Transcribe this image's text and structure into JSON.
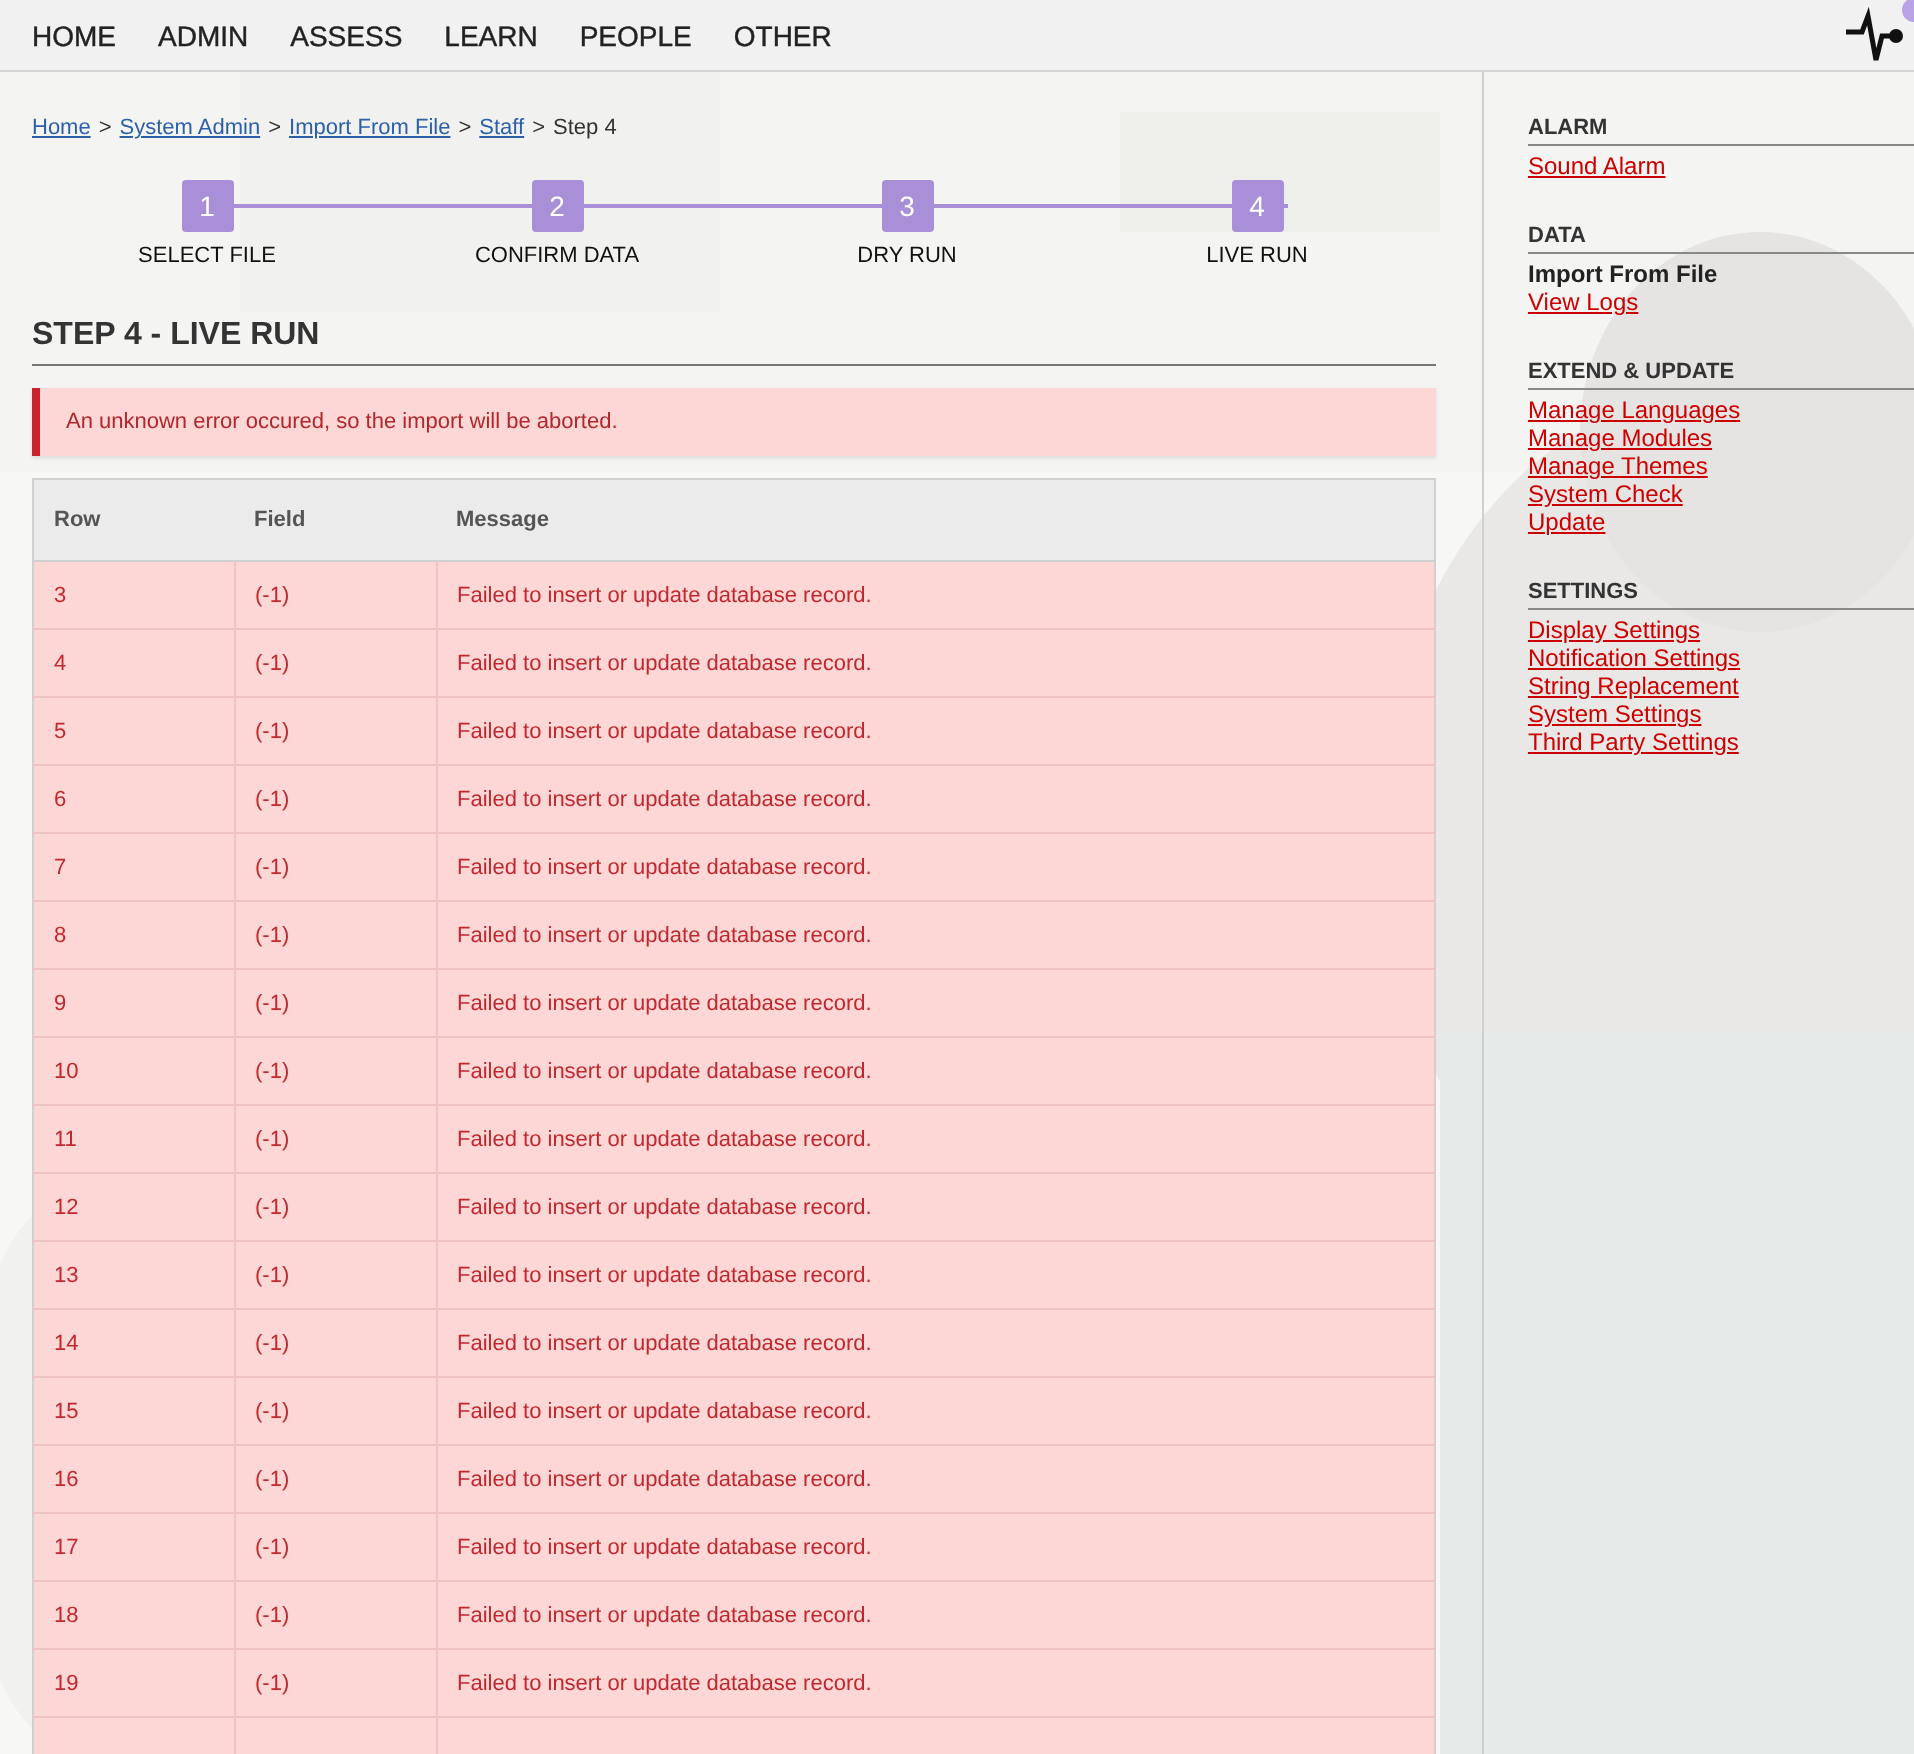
{
  "nav": {
    "items": [
      "HOME",
      "ADMIN",
      "ASSESS",
      "LEARN",
      "PEOPLE",
      "OTHER"
    ]
  },
  "breadcrumb": {
    "separator": ">",
    "items": [
      {
        "label": "Home",
        "kind": "link"
      },
      {
        "label": "System Admin",
        "kind": "link"
      },
      {
        "label": "Import From File",
        "kind": "link"
      },
      {
        "label": "Staff",
        "kind": "link"
      },
      {
        "label": "Step 4",
        "kind": "current"
      }
    ]
  },
  "steps": [
    {
      "number": "1",
      "label": "SELECT FILE"
    },
    {
      "number": "2",
      "label": "CONFIRM DATA"
    },
    {
      "number": "3",
      "label": "DRY RUN"
    },
    {
      "number": "4",
      "label": "LIVE RUN"
    }
  ],
  "heading": "STEP 4 - LIVE RUN",
  "alert": "An unknown error occured, so the import will be aborted.",
  "table": {
    "columns": [
      "Row",
      "Field",
      "Message"
    ],
    "rows": [
      [
        "3",
        "(-1)",
        "Failed to insert or update database record."
      ],
      [
        "4",
        "(-1)",
        "Failed to insert or update database record."
      ],
      [
        "5",
        "(-1)",
        "Failed to insert or update database record."
      ],
      [
        "6",
        "(-1)",
        "Failed to insert or update database record."
      ],
      [
        "7",
        "(-1)",
        "Failed to insert or update database record."
      ],
      [
        "8",
        "(-1)",
        "Failed to insert or update database record."
      ],
      [
        "9",
        "(-1)",
        "Failed to insert or update database record."
      ],
      [
        "10",
        "(-1)",
        "Failed to insert or update database record."
      ],
      [
        "11",
        "(-1)",
        "Failed to insert or update database record."
      ],
      [
        "12",
        "(-1)",
        "Failed to insert or update database record."
      ],
      [
        "13",
        "(-1)",
        "Failed to insert or update database record."
      ],
      [
        "14",
        "(-1)",
        "Failed to insert or update database record."
      ],
      [
        "15",
        "(-1)",
        "Failed to insert or update database record."
      ],
      [
        "16",
        "(-1)",
        "Failed to insert or update database record."
      ],
      [
        "17",
        "(-1)",
        "Failed to insert or update database record."
      ],
      [
        "18",
        "(-1)",
        "Failed to insert or update database record."
      ],
      [
        "19",
        "(-1)",
        "Failed to insert or update database record."
      ]
    ]
  },
  "sidebar": {
    "sections": [
      {
        "title": "ALARM",
        "items": [
          {
            "label": "Sound Alarm",
            "selected": false
          }
        ]
      },
      {
        "title": "DATA",
        "items": [
          {
            "label": "Import From File",
            "selected": true
          },
          {
            "label": "View Logs",
            "selected": false
          }
        ]
      },
      {
        "title": "EXTEND & UPDATE",
        "items": [
          {
            "label": "Manage Languages",
            "selected": false
          },
          {
            "label": "Manage Modules",
            "selected": false
          },
          {
            "label": "Manage Themes",
            "selected": false
          },
          {
            "label": "System Check",
            "selected": false
          },
          {
            "label": "Update",
            "selected": false
          }
        ]
      },
      {
        "title": "SETTINGS",
        "items": [
          {
            "label": "Display Settings",
            "selected": false
          },
          {
            "label": "Notification Settings",
            "selected": false
          },
          {
            "label": "String Replacement",
            "selected": false
          },
          {
            "label": "System Settings",
            "selected": false
          },
          {
            "label": "Third Party Settings",
            "selected": false
          }
        ]
      }
    ]
  }
}
